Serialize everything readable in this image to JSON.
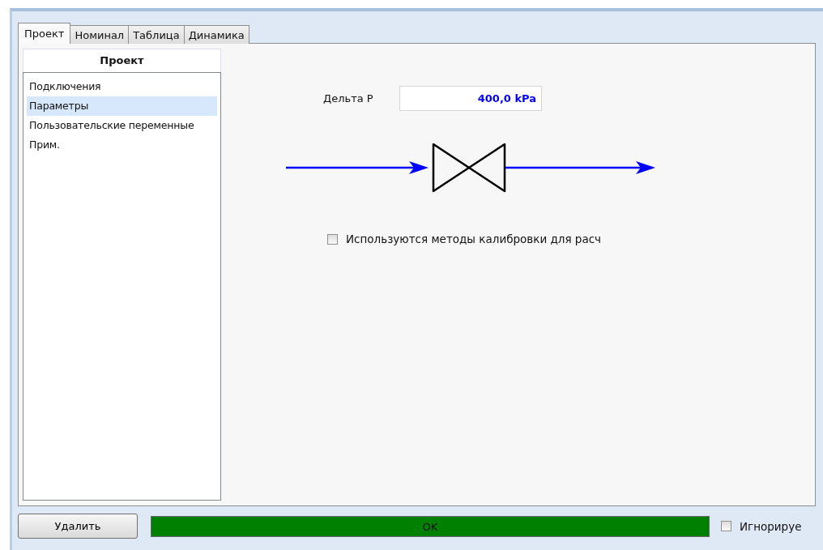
{
  "tabs": [
    {
      "label": "Проект",
      "selected": true
    },
    {
      "label": "Номинал",
      "selected": false
    },
    {
      "label": "Таблица",
      "selected": false
    },
    {
      "label": "Динамика",
      "selected": false
    }
  ],
  "sidebar": {
    "title": "Проект",
    "items": [
      {
        "label": "Подключения",
        "selected": false
      },
      {
        "label": "Параметры",
        "selected": true
      },
      {
        "label": "Пользовательские переменные",
        "selected": false
      },
      {
        "label": "Прим.",
        "selected": false
      }
    ]
  },
  "delta_p": {
    "label": "Дельта P",
    "value": "400,0 kPa"
  },
  "calibration": {
    "label": "Используются методы калибровки для расч",
    "checked": false
  },
  "delete_button": "Удалить",
  "status": {
    "text": "OK",
    "color": "#008000"
  },
  "ignore": {
    "label": "Игнорируе",
    "checked": false
  }
}
